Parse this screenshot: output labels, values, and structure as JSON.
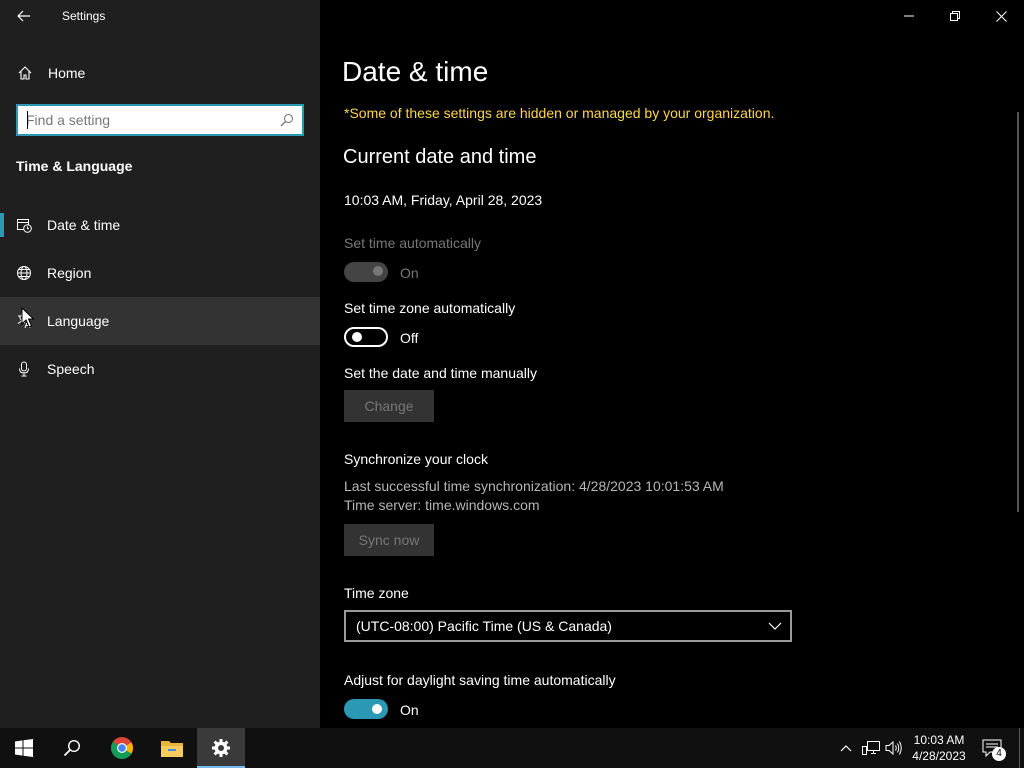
{
  "app": {
    "title": "Settings"
  },
  "sidebar": {
    "home_label": "Home",
    "search_placeholder": "Find a setting",
    "section_title": "Time & Language",
    "items": [
      {
        "label": "Date & time",
        "icon": "date-time-icon",
        "active": true
      },
      {
        "label": "Region",
        "icon": "globe-icon",
        "active": false
      },
      {
        "label": "Language",
        "icon": "language-icon",
        "active": false,
        "hovered": true
      },
      {
        "label": "Speech",
        "icon": "microphone-icon",
        "active": false
      }
    ]
  },
  "main": {
    "page_title": "Date & time",
    "org_notice": "*Some of these settings are hidden or managed by your organization.",
    "section_heading": "Current date and time",
    "current_datetime": "10:03 AM, Friday, April 28, 2023",
    "set_time_auto": {
      "label": "Set time automatically",
      "state": "On",
      "enabled": false
    },
    "set_tz_auto": {
      "label": "Set time zone automatically",
      "state": "Off",
      "enabled": true
    },
    "manual": {
      "label": "Set the date and time manually",
      "button": "Change"
    },
    "sync": {
      "label": "Synchronize your clock",
      "last_sync": "Last successful time synchronization: 4/28/2023 10:01:53 AM",
      "server": "Time server: time.windows.com",
      "button": "Sync now"
    },
    "time_zone": {
      "label": "Time zone",
      "value": "(UTC-08:00) Pacific Time (US & Canada)"
    },
    "dst": {
      "label": "Adjust for daylight saving time automatically",
      "state": "On"
    }
  },
  "taskbar": {
    "apps": [
      "start-icon",
      "search-icon",
      "chrome-icon",
      "file-explorer-icon",
      "settings-icon"
    ],
    "active_app": "settings-icon",
    "clock_time": "10:03 AM",
    "clock_date": "4/28/2023",
    "notification_count": "4"
  },
  "colors": {
    "accent": "#2b99b3",
    "notice": "#ffd54a",
    "sidebar_bg": "#1f1f1f",
    "main_bg": "#000000"
  }
}
